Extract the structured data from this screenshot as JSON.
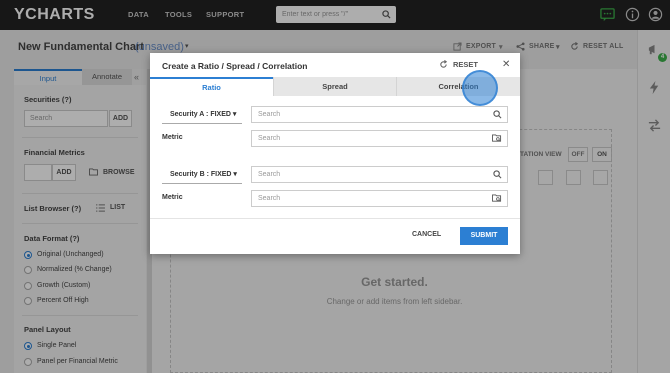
{
  "nav": {
    "logo": "YCHARTS",
    "links": [
      "DATA",
      "TOOLS",
      "SUPPORT"
    ],
    "search_placeholder": "Enter text or press \"/\"",
    "icons": [
      "chat-icon",
      "info-icon",
      "user-icon"
    ]
  },
  "header": {
    "title": "New Fundamental Chart",
    "unsaved": "(unsaved)",
    "export": "EXPORT",
    "share": "SHARE",
    "reset_all": "RESET ALL"
  },
  "right_toolbar": {
    "badge_count": "4",
    "icons": [
      "megaphone-icon",
      "lightning-icon",
      "swap-icon"
    ]
  },
  "sidebar": {
    "tabs": [
      "Input",
      "Annotate"
    ],
    "securities_title": "Securities (?)",
    "securities_placeholder": "Search",
    "add_label": "ADD",
    "financial_metrics_title": "Financial Metrics",
    "browse_label": "BROWSE",
    "list_browser_title": "List Browser (?)",
    "list_label": "LIST",
    "data_format_title": "Data Format (?)",
    "data_format_options": [
      "Original (Unchanged)",
      "Normalized (% Change)",
      "Growth (Custom)",
      "Percent Off High"
    ],
    "data_format_selected": 0,
    "panel_layout_title": "Panel Layout",
    "panel_layout_options": [
      "Single Panel",
      "Panel per Financial Metric"
    ],
    "panel_layout_selected": 0
  },
  "chart": {
    "annotation_view": "TATION VIEW",
    "off": "OFF",
    "on": "ON",
    "get_started": "Get started.",
    "get_started_sub": "Change or add items from left sidebar."
  },
  "modal": {
    "title": "Create a Ratio / Spread / Correlation",
    "reset": "RESET",
    "tabs": [
      "Ratio",
      "Spread",
      "Correlation"
    ],
    "active_tab": "Ratio",
    "security_a": "Security A : FIXED",
    "security_b": "Security B : FIXED",
    "metric_label": "Metric",
    "search_placeholder": "Search",
    "cancel": "CANCEL",
    "submit": "SUBMIT"
  },
  "colors": {
    "accent": "#2c7fd3",
    "nav_bg": "#222222",
    "badge": "#3cb04a"
  }
}
